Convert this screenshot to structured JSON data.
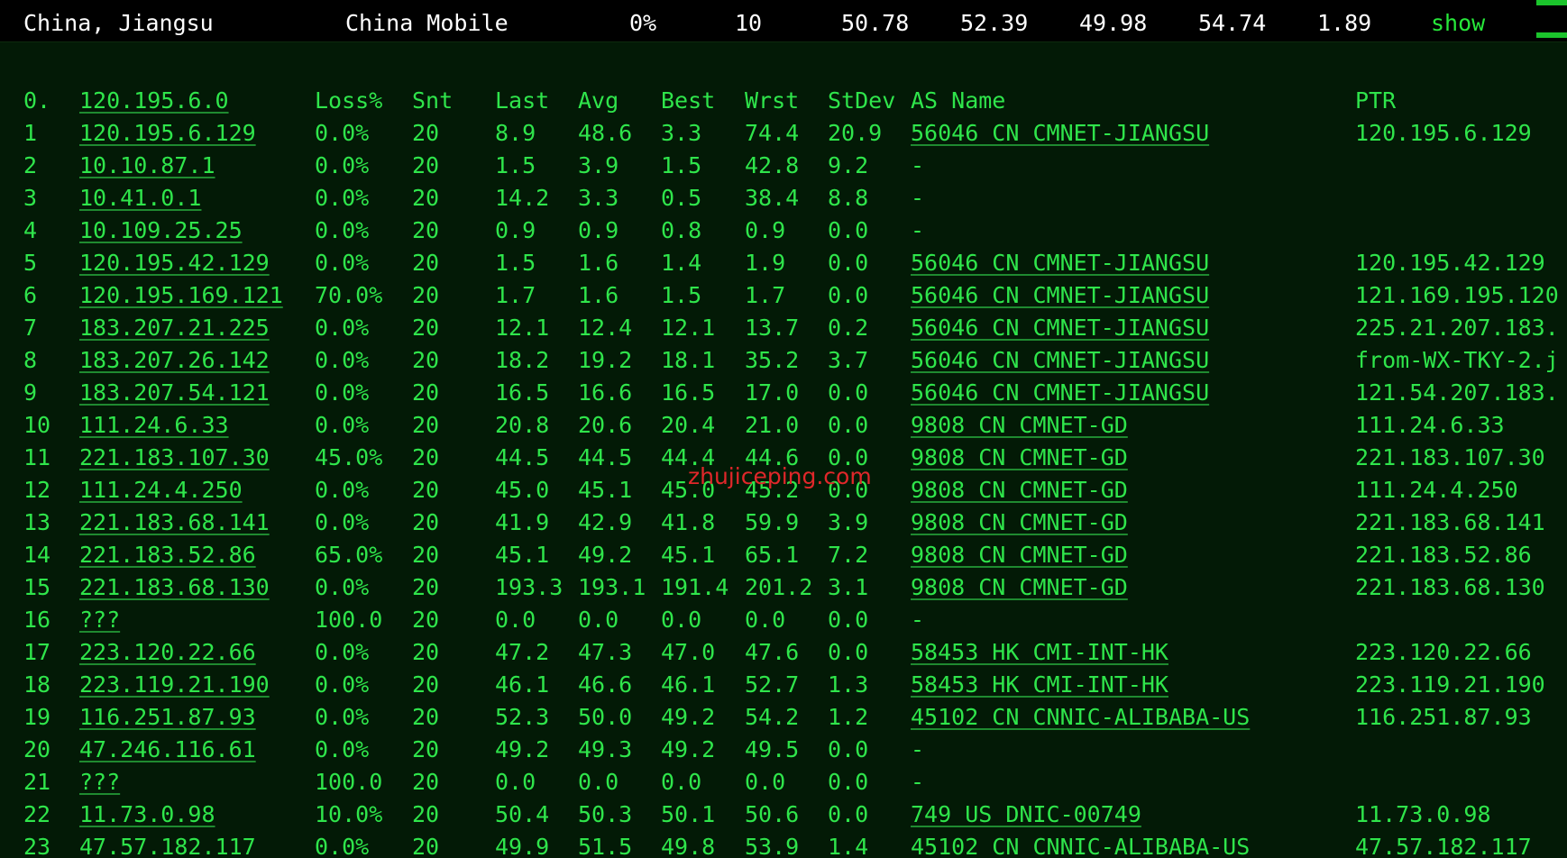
{
  "header": {
    "location": "China, Jiangsu",
    "isp": "China Mobile",
    "loss": "0%",
    "snt": "10",
    "last": "50.78",
    "avg": "52.39",
    "best": "49.98",
    "wrst": "54.74",
    "stdev": "1.89",
    "show_label": "show"
  },
  "table": {
    "headers": {
      "index": "0.",
      "host": "120.195.6.0",
      "loss": "Loss%",
      "snt": "Snt",
      "last": "Last",
      "avg": "Avg",
      "best": "Best",
      "wrst": "Wrst",
      "stdev": "StDev",
      "as_name": "AS Name",
      "ptr": "PTR"
    },
    "rows": [
      {
        "i": "1",
        "host": "120.195.6.129",
        "loss": "0.0%",
        "snt": "20",
        "last": "8.9",
        "avg": "48.6",
        "best": "3.3",
        "wrst": "74.4",
        "stdev": "20.9",
        "as": "56046 CN CMNET-JIANGSU",
        "ptr": "120.195.6.129"
      },
      {
        "i": "2",
        "host": "10.10.87.1",
        "loss": "0.0%",
        "snt": "20",
        "last": "1.5",
        "avg": "3.9",
        "best": "1.5",
        "wrst": "42.8",
        "stdev": "9.2",
        "as": "-",
        "ptr": ""
      },
      {
        "i": "3",
        "host": "10.41.0.1",
        "loss": "0.0%",
        "snt": "20",
        "last": "14.2",
        "avg": "3.3",
        "best": "0.5",
        "wrst": "38.4",
        "stdev": "8.8",
        "as": "-",
        "ptr": ""
      },
      {
        "i": "4",
        "host": "10.109.25.25",
        "loss": "0.0%",
        "snt": "20",
        "last": "0.9",
        "avg": "0.9",
        "best": "0.8",
        "wrst": "0.9",
        "stdev": "0.0",
        "as": "-",
        "ptr": ""
      },
      {
        "i": "5",
        "host": "120.195.42.129",
        "loss": "0.0%",
        "snt": "20",
        "last": "1.5",
        "avg": "1.6",
        "best": "1.4",
        "wrst": "1.9",
        "stdev": "0.0",
        "as": "56046 CN CMNET-JIANGSU",
        "ptr": "120.195.42.129"
      },
      {
        "i": "6",
        "host": "120.195.169.121",
        "loss": "70.0%",
        "snt": "20",
        "last": "1.7",
        "avg": "1.6",
        "best": "1.5",
        "wrst": "1.7",
        "stdev": "0.0",
        "as": "56046 CN CMNET-JIANGSU",
        "ptr": "121.169.195.120"
      },
      {
        "i": "7",
        "host": "183.207.21.225",
        "loss": "0.0%",
        "snt": "20",
        "last": "12.1",
        "avg": "12.4",
        "best": "12.1",
        "wrst": "13.7",
        "stdev": "0.2",
        "as": "56046 CN CMNET-JIANGSU",
        "ptr": "225.21.207.183."
      },
      {
        "i": "8",
        "host": "183.207.26.142",
        "loss": "0.0%",
        "snt": "20",
        "last": "18.2",
        "avg": "19.2",
        "best": "18.1",
        "wrst": "35.2",
        "stdev": "3.7",
        "as": "56046 CN CMNET-JIANGSU",
        "ptr": "from-WX-TKY-2.j"
      },
      {
        "i": "9",
        "host": "183.207.54.121",
        "loss": "0.0%",
        "snt": "20",
        "last": "16.5",
        "avg": "16.6",
        "best": "16.5",
        "wrst": "17.0",
        "stdev": "0.0",
        "as": "56046 CN CMNET-JIANGSU",
        "ptr": "121.54.207.183."
      },
      {
        "i": "10",
        "host": "111.24.6.33",
        "loss": "0.0%",
        "snt": "20",
        "last": "20.8",
        "avg": "20.6",
        "best": "20.4",
        "wrst": "21.0",
        "stdev": "0.0",
        "as": "9808  CN CMNET-GD",
        "ptr": "111.24.6.33"
      },
      {
        "i": "11",
        "host": "221.183.107.30",
        "loss": "45.0%",
        "snt": "20",
        "last": "44.5",
        "avg": "44.5",
        "best": "44.4",
        "wrst": "44.6",
        "stdev": "0.0",
        "as": "9808  CN CMNET-GD",
        "ptr": "221.183.107.30"
      },
      {
        "i": "12",
        "host": "111.24.4.250",
        "loss": "0.0%",
        "snt": "20",
        "last": "45.0",
        "avg": "45.1",
        "best": "45.0",
        "wrst": "45.2",
        "stdev": "0.0",
        "as": "9808  CN CMNET-GD",
        "ptr": "111.24.4.250"
      },
      {
        "i": "13",
        "host": "221.183.68.141",
        "loss": "0.0%",
        "snt": "20",
        "last": "41.9",
        "avg": "42.9",
        "best": "41.8",
        "wrst": "59.9",
        "stdev": "3.9",
        "as": "9808  CN CMNET-GD",
        "ptr": "221.183.68.141"
      },
      {
        "i": "14",
        "host": "221.183.52.86",
        "loss": "65.0%",
        "snt": "20",
        "last": "45.1",
        "avg": "49.2",
        "best": "45.1",
        "wrst": "65.1",
        "stdev": "7.2",
        "as": "9808  CN CMNET-GD",
        "ptr": "221.183.52.86"
      },
      {
        "i": "15",
        "host": "221.183.68.130",
        "loss": "0.0%",
        "snt": "20",
        "last": "193.3",
        "avg": "193.1",
        "best": "191.4",
        "wrst": "201.2",
        "stdev": "3.1",
        "as": "9808  CN CMNET-GD",
        "ptr": "221.183.68.130"
      },
      {
        "i": "16",
        "host": "???",
        "loss": "100.0",
        "snt": "20",
        "last": "0.0",
        "avg": "0.0",
        "best": "0.0",
        "wrst": "0.0",
        "stdev": "0.0",
        "as": "-",
        "ptr": ""
      },
      {
        "i": "17",
        "host": "223.120.22.66",
        "loss": "0.0%",
        "snt": "20",
        "last": "47.2",
        "avg": "47.3",
        "best": "47.0",
        "wrst": "47.6",
        "stdev": "0.0",
        "as": "58453 HK CMI-INT-HK",
        "ptr": "223.120.22.66"
      },
      {
        "i": "18",
        "host": "223.119.21.190",
        "loss": "0.0%",
        "snt": "20",
        "last": "46.1",
        "avg": "46.6",
        "best": "46.1",
        "wrst": "52.7",
        "stdev": "1.3",
        "as": "58453 HK CMI-INT-HK",
        "ptr": "223.119.21.190"
      },
      {
        "i": "19",
        "host": "116.251.87.93",
        "loss": "0.0%",
        "snt": "20",
        "last": "52.3",
        "avg": "50.0",
        "best": "49.2",
        "wrst": "54.2",
        "stdev": "1.2",
        "as": "45102 CN CNNIC-ALIBABA-US",
        "ptr": "116.251.87.93"
      },
      {
        "i": "20",
        "host": "47.246.116.61",
        "loss": "0.0%",
        "snt": "20",
        "last": "49.2",
        "avg": "49.3",
        "best": "49.2",
        "wrst": "49.5",
        "stdev": "0.0",
        "as": "-",
        "ptr": ""
      },
      {
        "i": "21",
        "host": "???",
        "loss": "100.0",
        "snt": "20",
        "last": "0.0",
        "avg": "0.0",
        "best": "0.0",
        "wrst": "0.0",
        "stdev": "0.0",
        "as": "-",
        "ptr": ""
      },
      {
        "i": "22",
        "host": "11.73.0.98",
        "loss": "10.0%",
        "snt": "20",
        "last": "50.4",
        "avg": "50.3",
        "best": "50.1",
        "wrst": "50.6",
        "stdev": "0.0",
        "as": "749   US DNIC-00749",
        "ptr": "11.73.0.98"
      },
      {
        "i": "23",
        "host": "47.57.182.117",
        "loss": "0.0%",
        "snt": "20",
        "last": "49.9",
        "avg": "51.5",
        "best": "49.8",
        "wrst": "53.9",
        "stdev": "1.4",
        "as": "45102 CN CNNIC-ALIBABA-US",
        "ptr": "47.57.182.117"
      }
    ]
  },
  "watermark": "zhujiceping.com",
  "colors": {
    "text_green": "#2fe54b",
    "background": "#031a06",
    "header_background": "#000000",
    "watermark_red": "#e0272a"
  }
}
